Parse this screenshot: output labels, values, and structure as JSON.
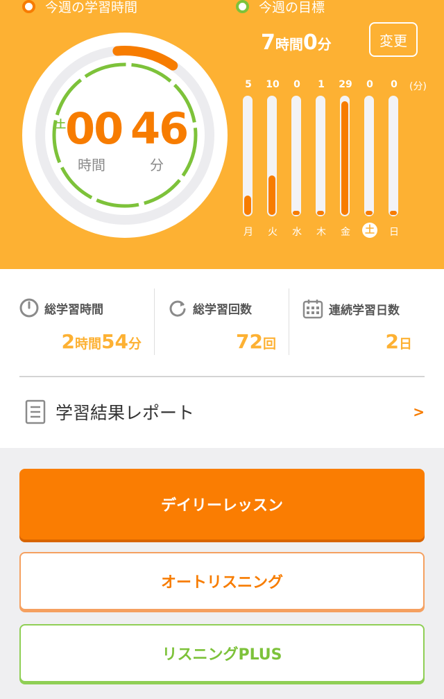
{
  "header": {
    "week_label": "今週の学習時間",
    "goal_label": "今週の目標",
    "goal_hours": "7",
    "goal_hours_unit": "時間",
    "goal_minutes": "0",
    "goal_minutes_unit": "分",
    "change_label": "変更",
    "day_mark": "土",
    "hours": "00",
    "minutes": "46",
    "hours_unit": "時間",
    "minutes_unit": "分",
    "ring_progress_fraction": 0.11
  },
  "chart_data": {
    "type": "bar",
    "categories": [
      "月",
      "火",
      "水",
      "木",
      "金",
      "土",
      "日"
    ],
    "values": [
      5,
      10,
      0,
      1,
      29,
      0,
      0
    ],
    "value_labels": [
      "5",
      "10",
      "0",
      "1",
      "29",
      "0",
      "0"
    ],
    "unit_label": "(分)",
    "ylim": [
      0,
      30
    ],
    "highlight_index": 5,
    "bar_color": "#f77c00"
  },
  "stats": [
    {
      "label": "総学習時間",
      "icon": "clock-icon",
      "parts": [
        {
          "n": "2",
          "u": "時間"
        },
        {
          "n": "54",
          "u": "分"
        }
      ]
    },
    {
      "label": "総学習回数",
      "icon": "refresh-icon",
      "parts": [
        {
          "n": "72",
          "u": "回"
        }
      ]
    },
    {
      "label": "連続学習日数",
      "icon": "calendar-icon",
      "parts": [
        {
          "n": "2",
          "u": "日"
        }
      ]
    }
  ],
  "report": {
    "label": "学習結果レポート",
    "chevron": ">"
  },
  "buttons": {
    "daily": "デイリーレッスン",
    "auto": "オートリスニング",
    "plus": "リスニングPLUS"
  },
  "colors": {
    "hero_bg": "#fdb133",
    "accent_orange": "#f77c00",
    "accent_green": "#7dc23a"
  }
}
